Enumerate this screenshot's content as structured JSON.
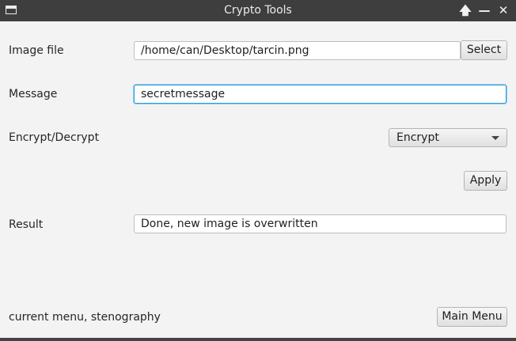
{
  "window": {
    "title": "Crypto Tools",
    "controls": {
      "maximize_glyph": "🡅",
      "minimize_glyph": "—",
      "close_glyph": "✕"
    }
  },
  "form": {
    "image_file": {
      "label": "Image file",
      "value": "/home/can/Desktop/tarcin.png",
      "button_label": "Select"
    },
    "message": {
      "label": "Message",
      "value": "secretmessage"
    },
    "mode": {
      "label": "Encrypt/Decrypt",
      "selected": "Encrypt"
    },
    "apply_label": "Apply",
    "result": {
      "label": "Result",
      "value": "Done, new image is overwritten"
    }
  },
  "footer": {
    "status": "current menu, stenography",
    "main_menu_label": "Main Menu"
  }
}
